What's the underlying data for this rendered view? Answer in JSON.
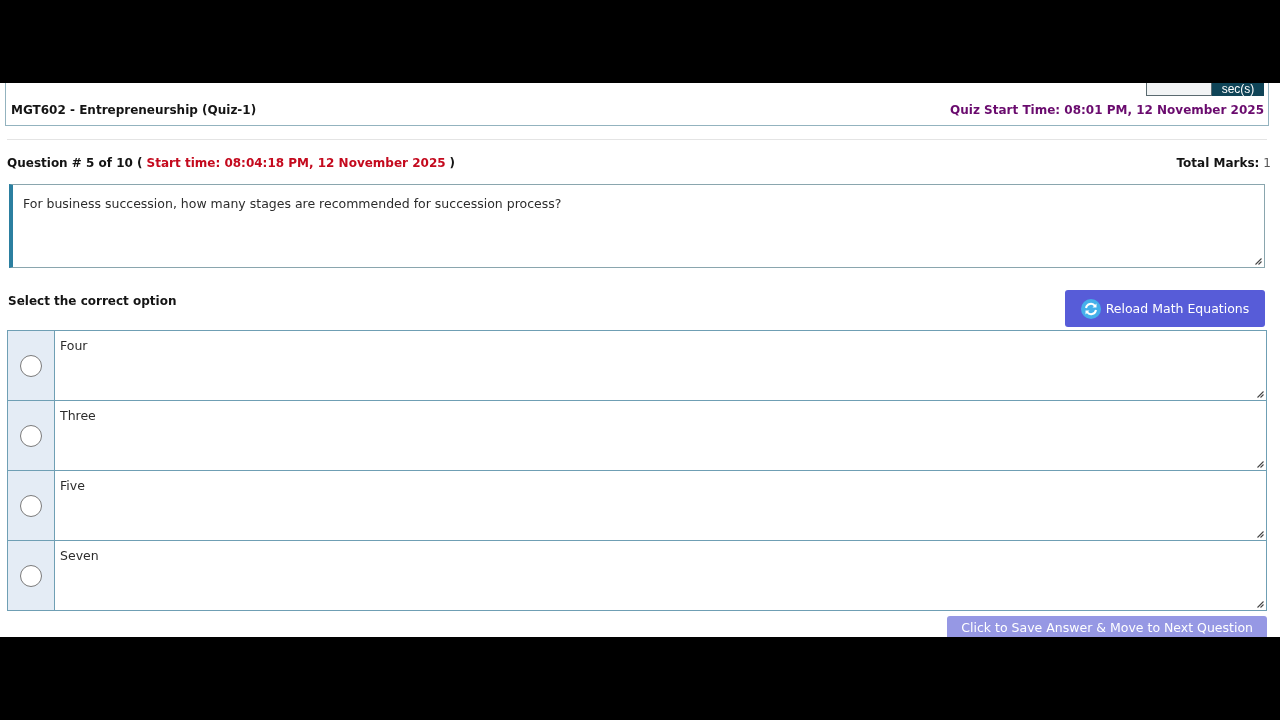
{
  "timer": {
    "unit_label": "sec(s)"
  },
  "header": {
    "course_title": "MGT602 - Entrepreneurship (Quiz-1)",
    "quiz_start_time": "Quiz Start Time: 08:01 PM, 12 November 2025"
  },
  "question": {
    "number_label": "Question # 5 of 10 (",
    "start_time": "Start time: 08:04:18 PM, 12 November 2025",
    "closing": ")",
    "total_marks_label": "Total Marks:",
    "total_marks_value": "1",
    "text": "For business succession, how many stages are recommended for succession process?"
  },
  "options_heading": "Select the correct option",
  "reload_button": {
    "label": "Reload Math Equations"
  },
  "options": [
    {
      "text": "Four",
      "selected": false
    },
    {
      "text": "Three",
      "selected": false
    },
    {
      "text": "Five",
      "selected": false
    },
    {
      "text": "Seven",
      "selected": false
    }
  ],
  "save_button": {
    "label": "Click to Save Answer & Move to Next Question",
    "disabled": true
  }
}
